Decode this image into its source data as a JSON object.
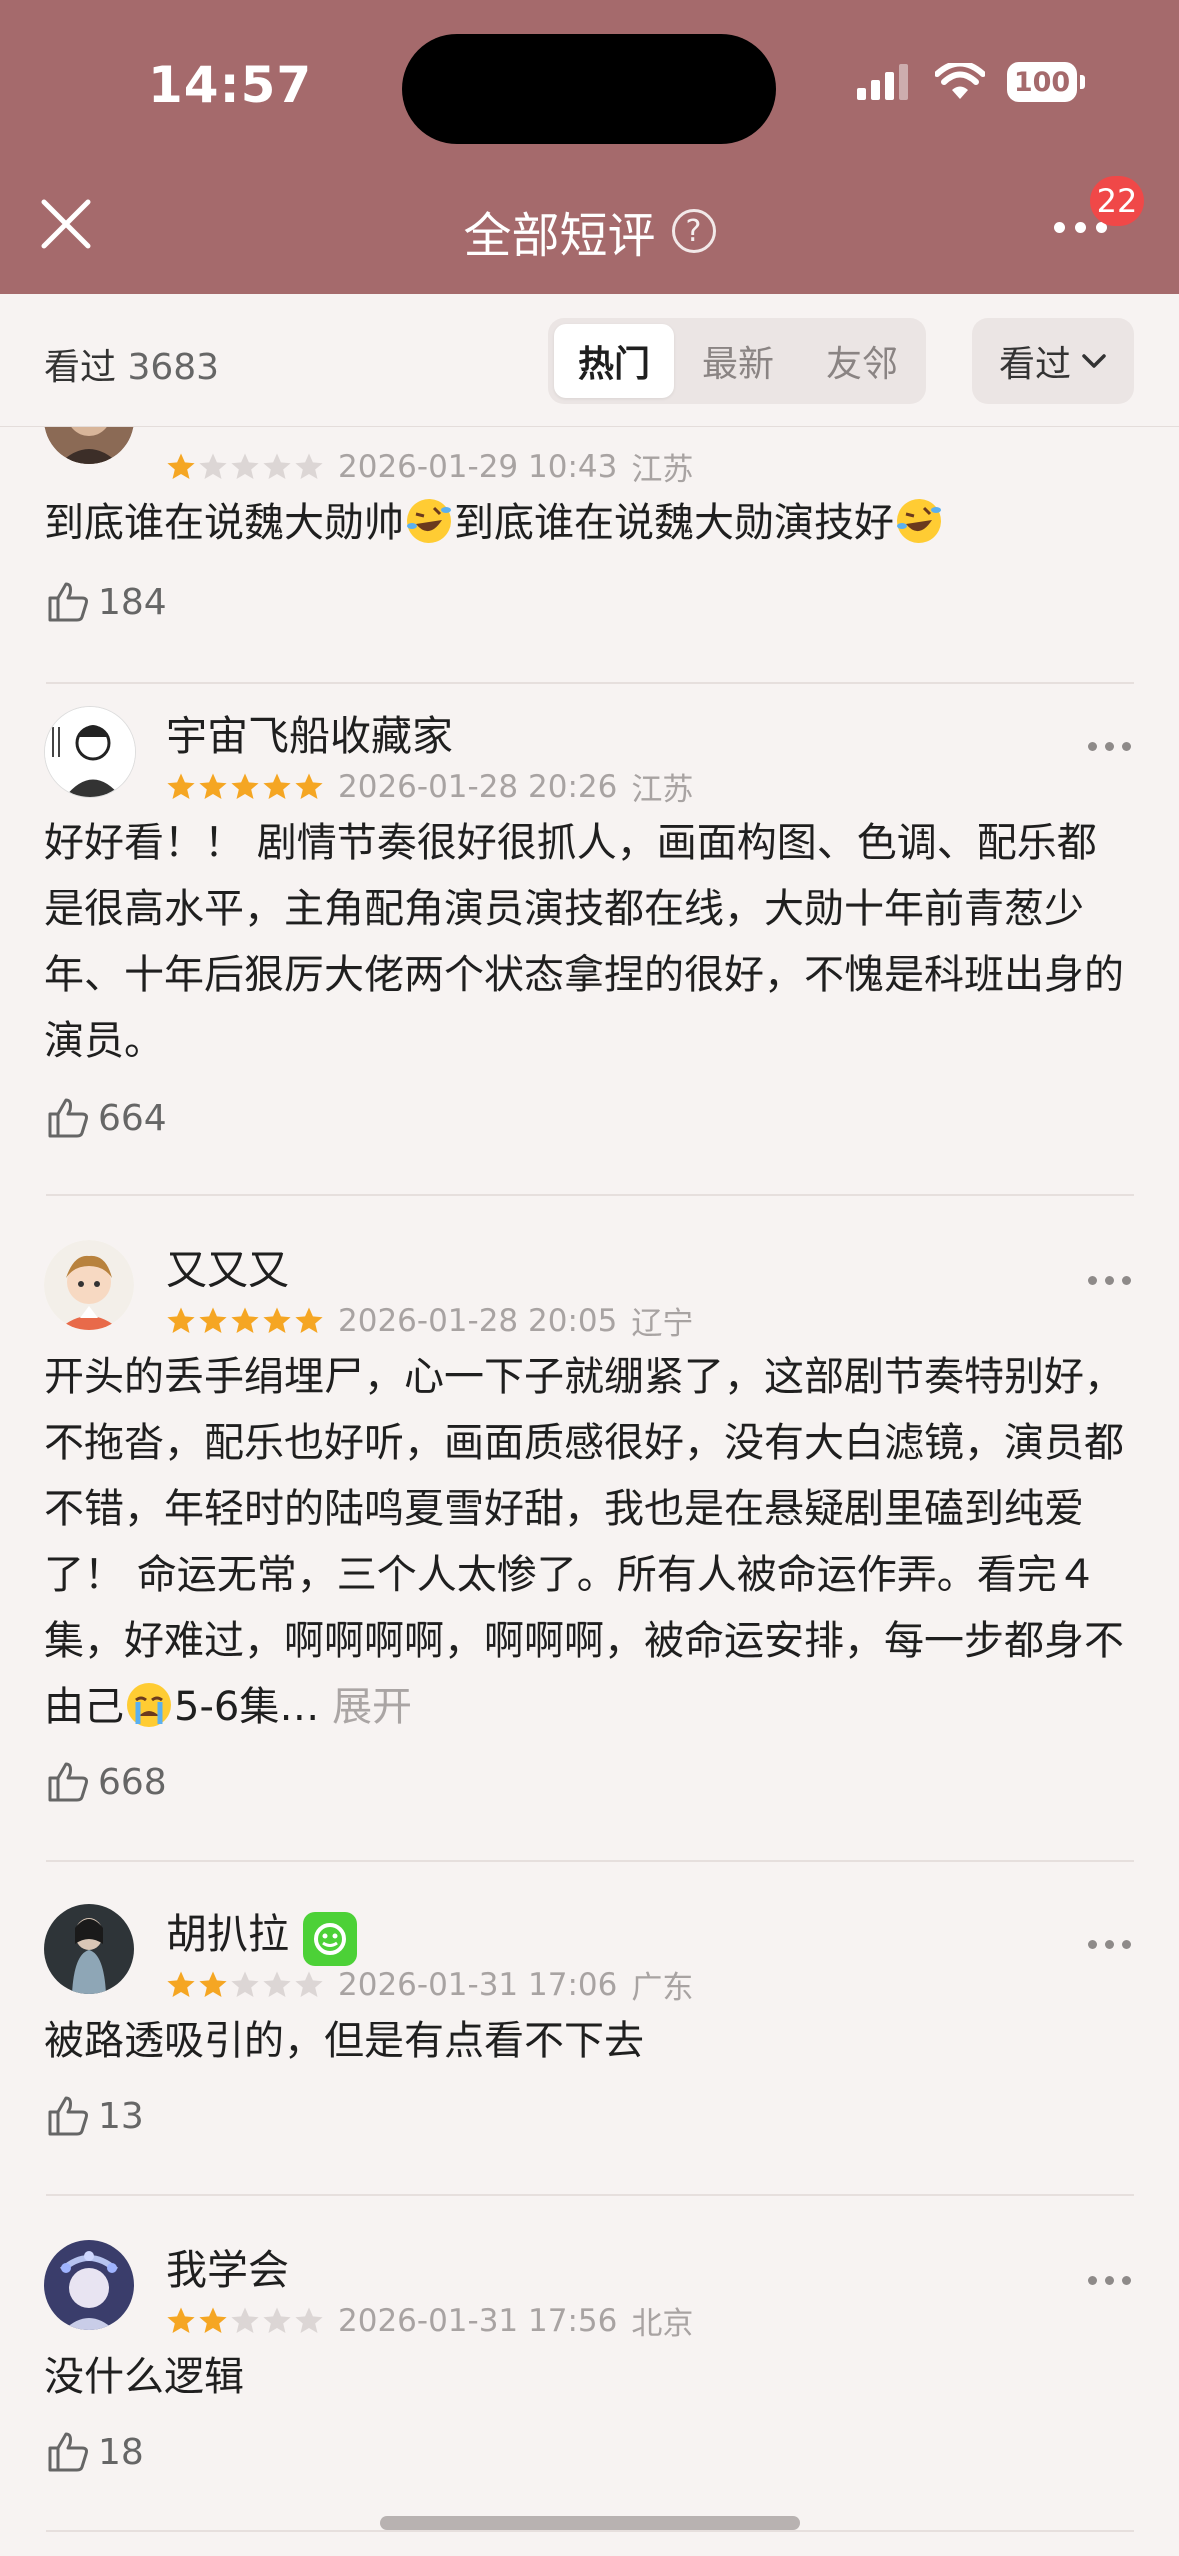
{
  "status_bar": {
    "time": "14:57",
    "battery": "100"
  },
  "nav": {
    "title": "全部短评",
    "help": "?",
    "badge": "22"
  },
  "filter": {
    "seen_label": "看过",
    "seen_count": "3683",
    "tabs": [
      "热门",
      "最新",
      "友邻"
    ],
    "active_tab": "热门",
    "sort_label": "看过"
  },
  "reviews": [
    {
      "user": "",
      "rating": 1,
      "time": "2026-01-29 10:43",
      "location": "江苏",
      "text_parts": [
        "到底谁在说魏大勋帅",
        "到底谁在说魏大勋演技好"
      ],
      "likes": "184"
    },
    {
      "user": "宇宙飞船收藏家",
      "rating": 5,
      "time": "2026-01-28 20:26",
      "location": "江苏",
      "text": "好好看！！ 剧情节奏很好很抓人，画面构图、色调、配乐都是很高水平，主角配角演员演技都在线，大勋十年前青葱少年、十年后狠厉大佬两个状态拿捏的很好，不愧是科班出身的演员。",
      "likes": "664"
    },
    {
      "user": "又又又",
      "rating": 5,
      "time": "2026-01-28 20:05",
      "location": "辽宁",
      "text": "开头的丢手绢埋尸，心一下子就绷紧了，这部剧节奏特别好，不拖沓，配乐也好听，画面质感很好，没有大白滤镜，演员都不错，年轻时的陆鸣夏雪好甜，我也是在悬疑剧里磕到纯爱了！ 命运无常，三个人太惨了。所有人被命运作弄。看完４集，好难过，啊啊啊啊，啊啊啊，被命运安排，每一步都身不由己",
      "text_tail": "5-6集…",
      "expand": "展开",
      "likes": "668"
    },
    {
      "user": "胡扒拉",
      "rating": 2,
      "time": "2026-01-31 17:06",
      "location": "广东",
      "text": "被路透吸引的，但是有点看不下去",
      "likes": "13"
    },
    {
      "user": "我学会",
      "rating": 2,
      "time": "2026-01-31 17:56",
      "location": "北京",
      "text": "没什么逻辑",
      "likes": "18"
    }
  ],
  "colors": {
    "header": "#a56a6c",
    "star_on": "#f5a623",
    "star_off": "#dcd6d5",
    "badge": "#f04848"
  }
}
